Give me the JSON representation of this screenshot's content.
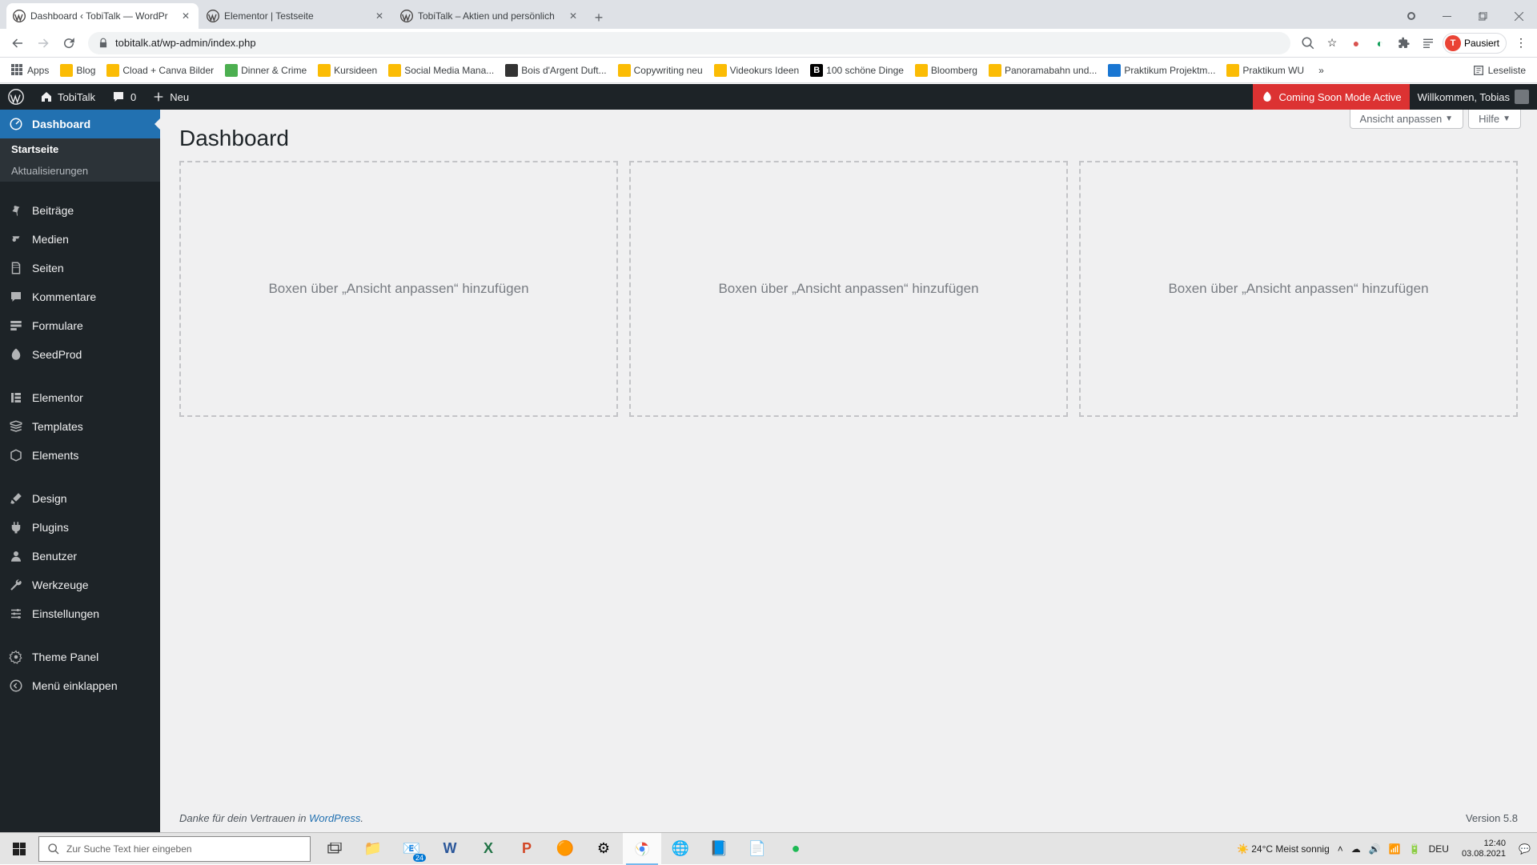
{
  "browser": {
    "tabs": [
      {
        "title": "Dashboard ‹ TobiTalk — WordPr",
        "active": true
      },
      {
        "title": "Elementor | Testseite",
        "active": false
      },
      {
        "title": "TobiTalk – Aktien und persönlich",
        "active": false
      }
    ],
    "url": "tobitalk.at/wp-admin/index.php",
    "profile_status": "Pausiert",
    "profile_initial": "T",
    "zoom_icon": "search-icon",
    "bookmarks": [
      {
        "label": "Apps",
        "icon": "apps"
      },
      {
        "label": "Blog"
      },
      {
        "label": "Cload + Canva Bilder"
      },
      {
        "label": "Dinner & Crime",
        "icon": "custom1"
      },
      {
        "label": "Kursideen"
      },
      {
        "label": "Social Media Mana..."
      },
      {
        "label": "Bois d'Argent Duft...",
        "icon": "custom2"
      },
      {
        "label": "Copywriting neu"
      },
      {
        "label": "Videokurs Ideen"
      },
      {
        "label": "100 schöne Dinge",
        "icon": "custom3"
      },
      {
        "label": "Bloomberg"
      },
      {
        "label": "Panoramabahn und..."
      },
      {
        "label": "Praktikum Projektm...",
        "icon": "custom4"
      },
      {
        "label": "Praktikum WU"
      }
    ],
    "reading_list": "Leseliste"
  },
  "wp_adminbar": {
    "site_name": "TobiTalk",
    "comments_count": "0",
    "new_label": "Neu",
    "coming_soon": "Coming Soon Mode Active",
    "welcome": "Willkommen, Tobias"
  },
  "sidebar": {
    "items": [
      {
        "label": "Dashboard",
        "icon": "dashboard",
        "current": true,
        "sub": [
          {
            "label": "Startseite",
            "active": true
          },
          {
            "label": "Aktualisierungen",
            "active": false
          }
        ]
      },
      {
        "label": "Beiträge",
        "icon": "posts"
      },
      {
        "label": "Medien",
        "icon": "media"
      },
      {
        "label": "Seiten",
        "icon": "pages"
      },
      {
        "label": "Kommentare",
        "icon": "comments"
      },
      {
        "label": "Formulare",
        "icon": "forms"
      },
      {
        "label": "SeedProd",
        "icon": "seedprod"
      },
      {
        "label": "Elementor",
        "icon": "elementor"
      },
      {
        "label": "Templates",
        "icon": "templates"
      },
      {
        "label": "Elements",
        "icon": "elements"
      },
      {
        "label": "Design",
        "icon": "design"
      },
      {
        "label": "Plugins",
        "icon": "plugins"
      },
      {
        "label": "Benutzer",
        "icon": "users"
      },
      {
        "label": "Werkzeuge",
        "icon": "tools"
      },
      {
        "label": "Einstellungen",
        "icon": "settings"
      },
      {
        "label": "Theme Panel",
        "icon": "themepanel"
      }
    ],
    "collapse": "Menü einklappen"
  },
  "main": {
    "page_title": "Dashboard",
    "screen_options": "Ansicht anpassen",
    "help": "Hilfe",
    "placeholder_text": "Boxen über „Ansicht anpassen“ hinzufügen",
    "footer_thanks": "Danke für dein Vertrauen in ",
    "footer_link": "WordPress",
    "footer_dot": ".",
    "version": "Version 5.8"
  },
  "taskbar": {
    "search_placeholder": "Zur Suche Text hier eingeben",
    "weather_temp": "24°C",
    "weather_desc": "Meist sonnig",
    "lang": "DEU",
    "time": "12:40",
    "date": "03.08.2021"
  }
}
